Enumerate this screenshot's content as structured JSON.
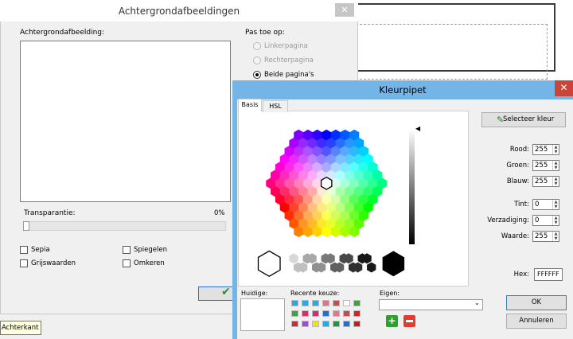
{
  "background_dialog": {
    "title": "Achtergrondafbeeldingen",
    "close": "✕",
    "image_label": "Achtergrondafbeelding:",
    "apply_label": "Pas toe op:",
    "apply_options": [
      {
        "label": "Linkerpagina",
        "selected": false,
        "enabled": false
      },
      {
        "label": "Rechterpagina",
        "selected": false,
        "enabled": false
      },
      {
        "label": "Beide pagina's",
        "selected": true,
        "enabled": true
      }
    ],
    "transparency_label": "Transparantie:",
    "transparency_value": "0%",
    "transparency_level": 0,
    "checkboxes": [
      {
        "label": "Sepia",
        "checked": false
      },
      {
        "label": "Spiegelen",
        "checked": false
      },
      {
        "label": "Grijswaarden",
        "checked": false
      },
      {
        "label": "Omkeren",
        "checked": false
      }
    ],
    "ok_glyph": "✔"
  },
  "tooltip": "Achterkant",
  "color_picker": {
    "title": "Kleurpipet",
    "close": "✕",
    "tabs": [
      "Basis",
      "HSL"
    ],
    "active_tab": "Basis",
    "select_color_button": "Selecteer kleur",
    "fields": [
      {
        "label": "Rood:",
        "value": "255"
      },
      {
        "label": "Groen:",
        "value": "255"
      },
      {
        "label": "Blauw:",
        "value": "255"
      },
      {
        "label": "Tint:",
        "value": "0"
      },
      {
        "label": "Verzadiging:",
        "value": "0"
      },
      {
        "label": "Waarde:",
        "value": "255"
      }
    ],
    "hex_label": "Hex:",
    "hex_value": "FFFFFF",
    "current_label": "Huidige:",
    "recent_label": "Recente keuze:",
    "custom_label": "Eigen:",
    "custom_value": "",
    "add_glyph": "+",
    "ok": "OK",
    "cancel": "Annuleren",
    "recent_colors": [
      "#2aa8e0",
      "#2aa8e0",
      "#2aa8e0",
      "#d57a8a",
      "#c0504d",
      "#ffffff",
      "#3aa63a",
      "#3aa63a",
      "#d12f6c",
      "#d12f6c",
      "#2a6cc9",
      "#e7748a",
      "#c0504d",
      "#e02020",
      "#c03030",
      "#a050c0",
      "#f0e020",
      "#2aa8e0",
      "#1a9a3a",
      "#2a6cc9",
      "#c02020"
    ],
    "selected_color": "#ffffff"
  }
}
